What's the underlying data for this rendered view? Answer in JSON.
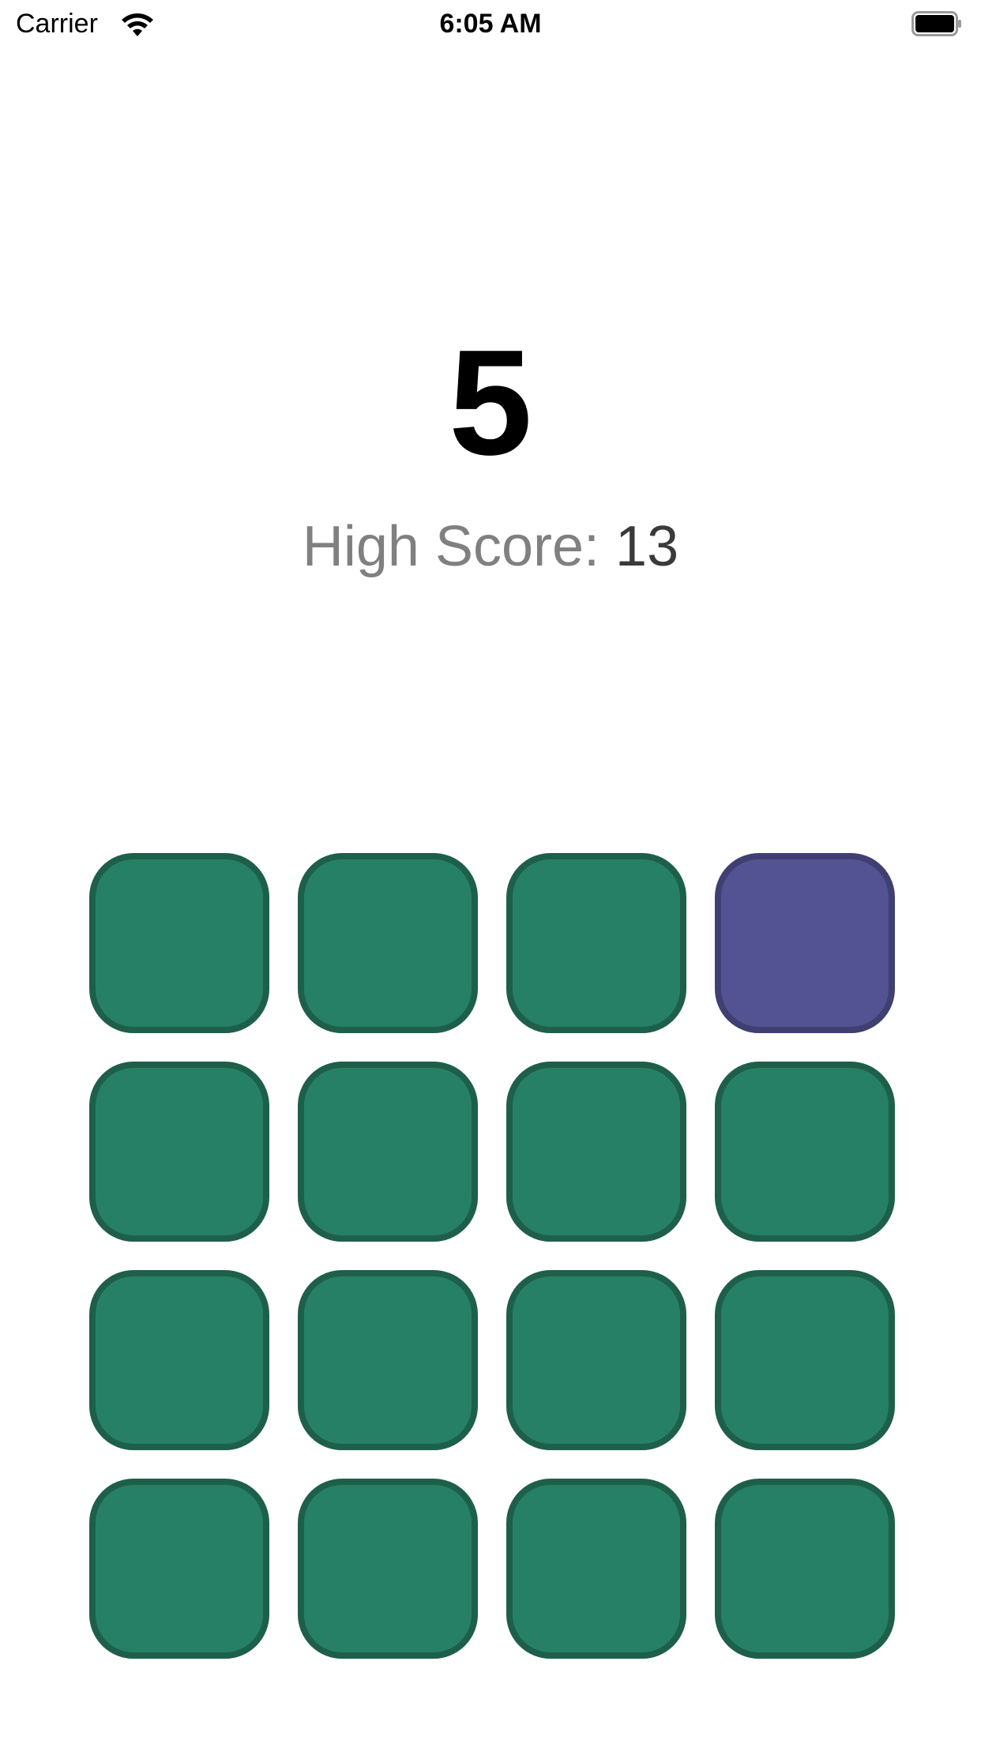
{
  "status_bar": {
    "carrier": "Carrier",
    "time": "6:05 AM",
    "wifi_icon": "wifi-icon",
    "battery_icon": "battery-icon"
  },
  "game": {
    "score": "5",
    "high_score_label": "High Score:",
    "high_score_value": "13"
  },
  "grid": {
    "rows": 4,
    "cols": 4,
    "tile_color": "#268066",
    "tile_border_color": "#1e5f4a",
    "lit_tile_color": "#535393",
    "lit_tile_border_color": "#3f3f72",
    "lit_tiles": [
      [
        0,
        3
      ]
    ]
  }
}
